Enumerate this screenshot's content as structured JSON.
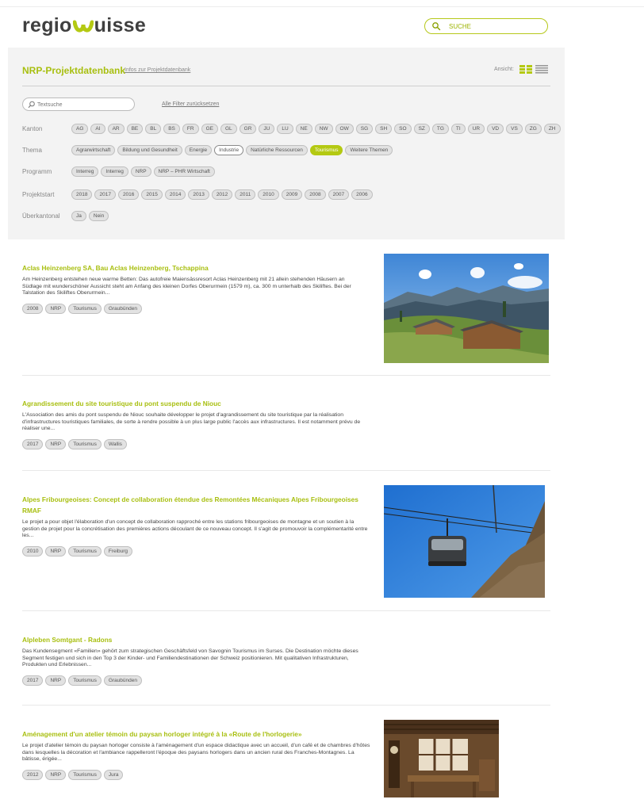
{
  "header": {
    "logo_left": "regio",
    "logo_right": "uisse",
    "search_placeholder": "SUCHE"
  },
  "database": {
    "title": "NRP-Projektdatenbank",
    "info_link": "Infos zur Projektdatenbank",
    "view_label": "Ansicht:",
    "text_search_placeholder": "Textsuche",
    "reset_link": "Alle Filter zurücksetzen"
  },
  "filters": [
    {
      "label": "Kanton",
      "options": [
        "AG",
        "AI",
        "AR",
        "BE",
        "BL",
        "BS",
        "FR",
        "GE",
        "GL",
        "GR",
        "JU",
        "LU",
        "NE",
        "NW",
        "OW",
        "SG",
        "SH",
        "SO",
        "SZ",
        "TG",
        "TI",
        "UR",
        "VD",
        "VS",
        "ZG",
        "ZH"
      ]
    },
    {
      "label": "Thema",
      "options": [
        "Agrarwirtschaft",
        "Bildung und Gesundheit",
        "Energie",
        "Industrie",
        "Natürliche Ressourcen",
        "Tourismus",
        "Weitere Themen"
      ],
      "active": "Tourismus",
      "outlined": "Industrie"
    },
    {
      "label": "Programm",
      "options": [
        "Interreg",
        "Interreg",
        "NRP",
        "NRP – PHR Wirtschaft"
      ]
    },
    {
      "label": "Projektstart",
      "options": [
        "2018",
        "2017",
        "2016",
        "2015",
        "2014",
        "2013",
        "2012",
        "2011",
        "2010",
        "2009",
        "2008",
        "2007",
        "2006"
      ]
    },
    {
      "label": "Überkantonal",
      "options": [
        "Ja",
        "Nein"
      ]
    }
  ],
  "projects": [
    {
      "title": "Aclas Heinzenberg SA, Bau Aclas Heinzenberg, Tschappina",
      "description": "Am Heinzenberg entstehen neue warme Betten: Das autofreie Maiensässresort Aclas Heinzenberg mit 21 allein stehenden Häusern an Südlage mit wunderschöner Aussicht steht am Anfang des kleinen Dorfes Oberurmein (1579 m), ca. 300 m unterhalb des Skiliftes. Bei der Talstation des Skiliftes Oberurmein...",
      "tags": [
        "2008",
        "NRP",
        "Tourismus",
        "Graubünden"
      ]
    },
    {
      "title": "Agrandissement du site touristique du pont suspendu de Niouc",
      "description": "L'Association des amis du pont suspendu de Niouc souhaite développer le projet d'agrandissement du site touristique par la réalisation d'infrastructures touristiques familiales, de sorte à rendre possible à un plus large public l'accès aux infrastructures. Il est notamment prévu de réaliser une...",
      "tags": [
        "2017",
        "NRP",
        "Tourismus",
        "Wallis"
      ]
    },
    {
      "title": "Alpes Fribourgeoises: Concept de collaboration étendue des Remontées Mécaniques Alpes Fribourgeoises RMAF",
      "description": "Le projet a pour objet l'élaboration d'un concept de collaboration rapproché entre les stations fribourgeoises de montagne et un soutien à la gestion de projet pour la concrétisation des premières actions découlant de ce nouveau concept. Il s'agit de promouvoir la complémentarité entre les...",
      "tags": [
        "2010",
        "NRP",
        "Tourismus",
        "Freiburg"
      ]
    },
    {
      "title": "Alpleben Somtgant - Radons",
      "description": "Das Kundensegment «Familien» gehört zum strategischen Geschäftsfeld von Savognin Tourismus im Surses. Die Destination möchte dieses Segment festigen und sich in den Top 3 der Kinder- und Familiendestinationen der Schweiz positionieren. Mit qualitativen Infrastrukturen, Produkten und Erlebnissen...",
      "tags": [
        "2017",
        "NRP",
        "Tourismus",
        "Graubünden"
      ]
    },
    {
      "title": "Aménagement d'un atelier témoin du paysan horloger intégré à la «Route de l'horlogerie»",
      "description": "Le projet d'atelier témoin du paysan horloger consiste à l'aménagement d'un espace didactique avec un accueil, d'un café et de chambres d'hôtes dans lesquelles la décoration et l'ambiance rappelleront l'époque des paysans horlogers dans un ancien rural des Franches-Montagnes. La bâtisse, érigée...",
      "tags": [
        "2012",
        "NRP",
        "Tourismus",
        "Jura"
      ]
    }
  ],
  "colors": {
    "accent": "#a8bf10",
    "panel": "#f3f3f3"
  }
}
